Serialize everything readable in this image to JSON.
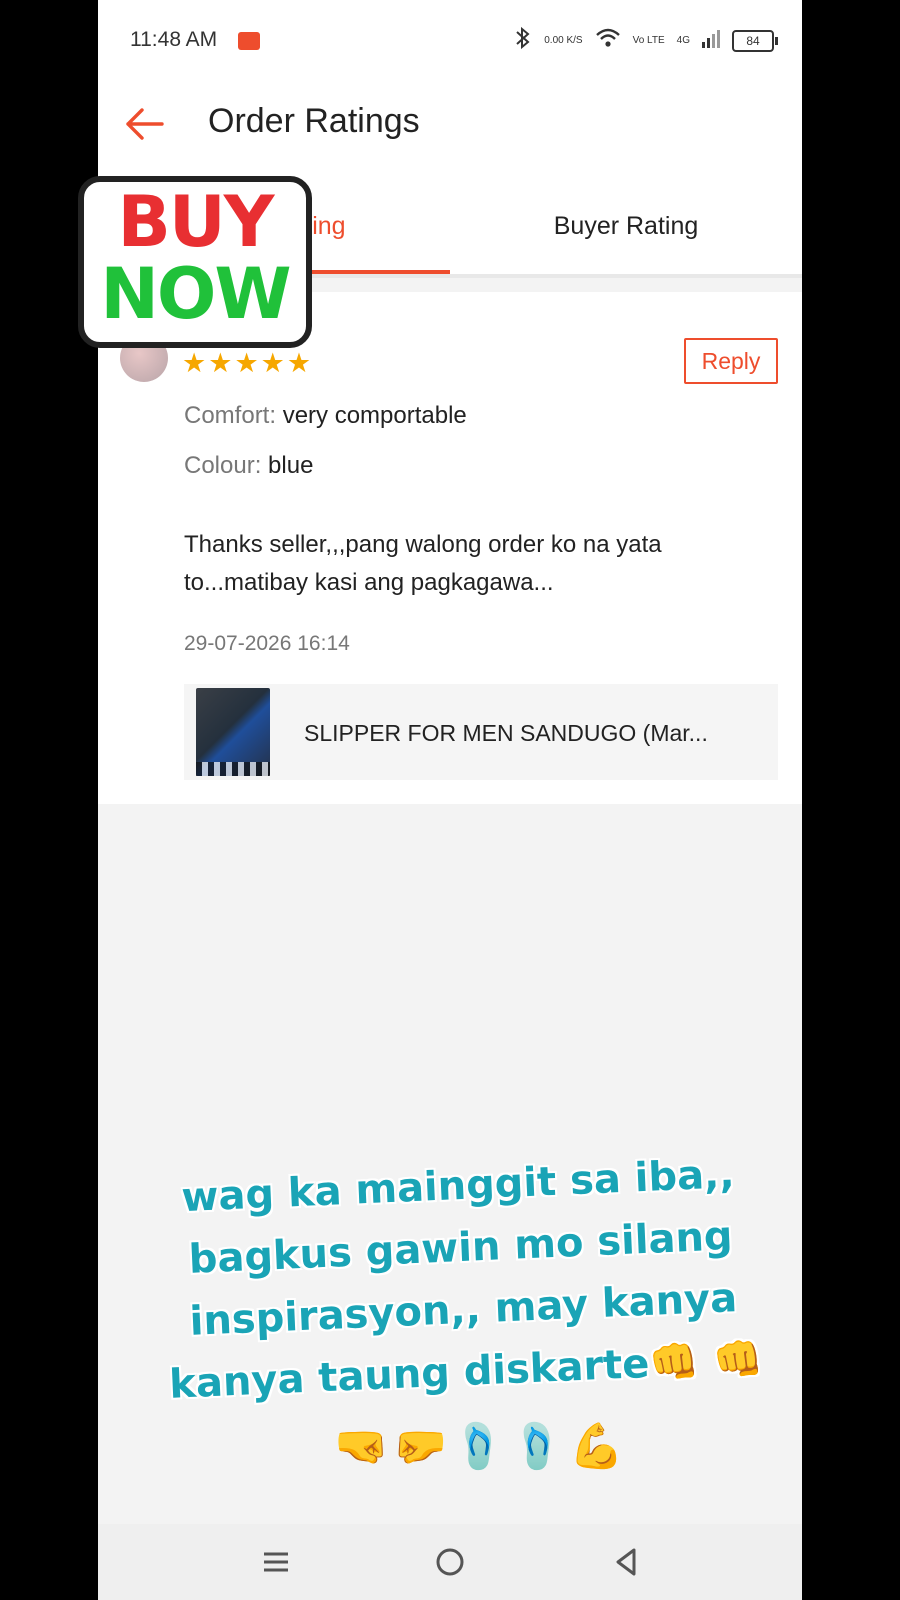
{
  "status": {
    "time": "11:48 AM",
    "speed": "0.00\nK/S",
    "network": "Vo LTE",
    "signal": "4G",
    "battery": "84"
  },
  "header": {
    "title": "Order Ratings"
  },
  "tabs": [
    {
      "label": "Seller Rating",
      "active": true
    },
    {
      "label": "Buyer Rating",
      "active": false
    }
  ],
  "review": {
    "rating": 5,
    "reply_label": "Reply",
    "attributes": [
      {
        "label": "Comfort:",
        "value": "very comportable"
      },
      {
        "label": "Colour:",
        "value": "blue"
      }
    ],
    "comment": "Thanks seller,,,pang walong order ko na yata to...matibay kasi ang pagkagawa...",
    "date": "29-07-2026 16:14",
    "product": {
      "name": "SLIPPER FOR MEN SANDUGO (Mar..."
    }
  },
  "overlay": {
    "sticker_line1": "BUY",
    "sticker_line2": "NOW",
    "caption": "wag ka mainggit sa iba,, bagkus gawin mo silang inspirasyon,, may kanya kanya taung diskarte👊 👊",
    "caption_emojis": "🤜🤛🩴🩴💪"
  },
  "colors": {
    "accent": "#ee4d2d",
    "star": "#f6a700",
    "caption": "#1aa4b6"
  }
}
